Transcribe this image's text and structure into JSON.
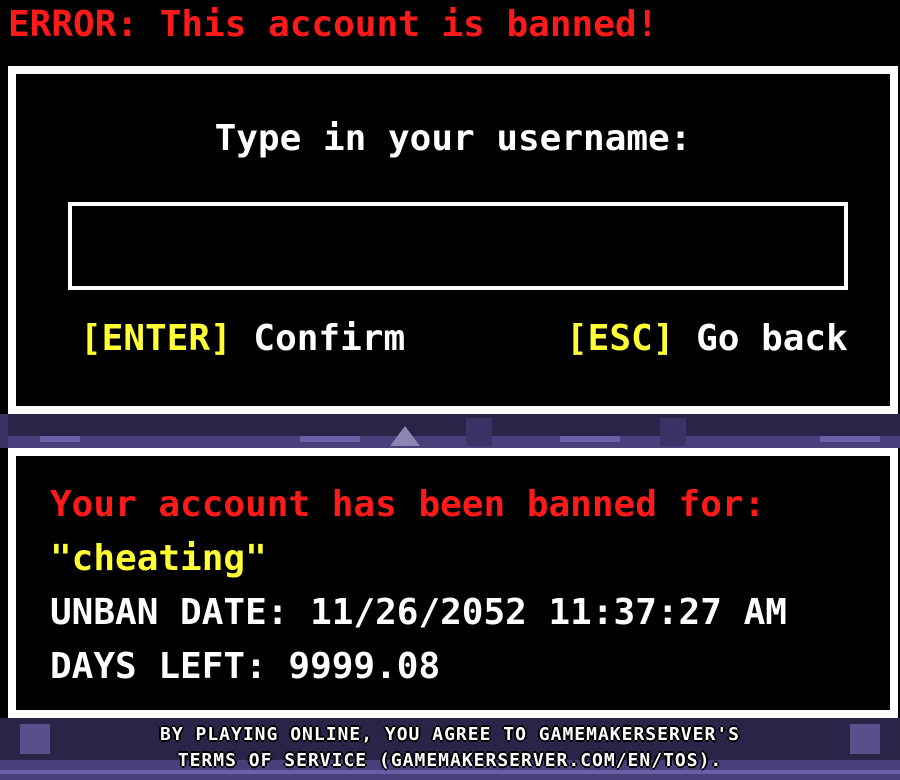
{
  "banner": {
    "error_text": "ERROR: This account is banned!"
  },
  "login": {
    "prompt": "Type in your username:",
    "username_value": "",
    "confirm_key": "[ENTER]",
    "confirm_label": "Confirm",
    "back_key": "[ESC]",
    "back_label": "Go back"
  },
  "ban": {
    "title": "Your account has been banned for:",
    "reason": "\"cheating\"",
    "unban_date": "UNBAN DATE: 11/26/2052 11:37:27 AM",
    "days_left": "DAYS LEFT: 9999.08"
  },
  "footer": {
    "tos_line1": "BY PLAYING ONLINE, YOU AGREE TO GAMEMAKERSERVER'S",
    "tos_line2": "TERMS OF SERVICE (GAMEMAKERSERVER.COM/EN/TOS)."
  },
  "colors": {
    "error": "#ff1a1a",
    "highlight": "#ffff33",
    "text": "#ffffff",
    "panel_bg": "#000000",
    "scene": "#4a3f7a"
  }
}
